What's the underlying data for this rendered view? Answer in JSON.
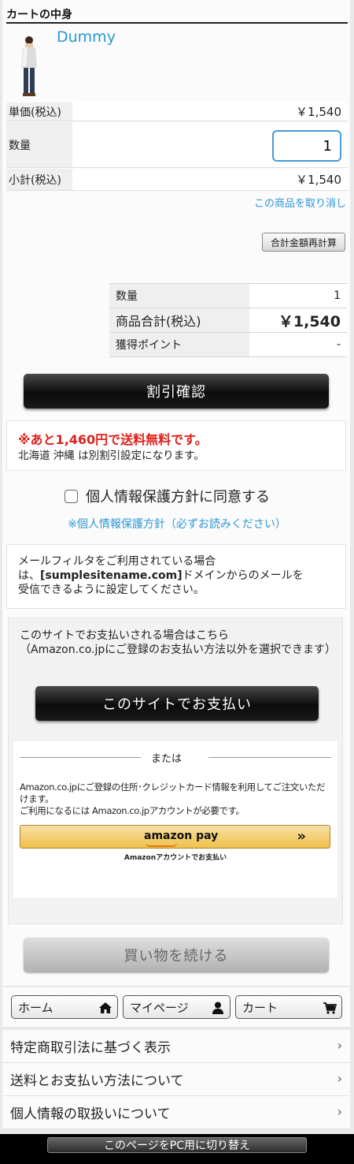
{
  "cart": {
    "title": "カートの中身",
    "product_name": "Dummy",
    "unit_price_label": "単価(税込)",
    "unit_price_value": "￥1,540",
    "qty_label": "数量",
    "qty_value": "1",
    "subtotal_label": "小計(税込)",
    "subtotal_value": "￥1,540",
    "remove_link": "この商品を取り消し",
    "recalc_button": "合計金額再計算"
  },
  "summary": {
    "rows": [
      {
        "label": "数量",
        "value": "1"
      },
      {
        "label": "商品合計(税込)",
        "value": "￥1,540"
      },
      {
        "label": "獲得ポイント",
        "value": "-"
      }
    ]
  },
  "discount_button": "割引確認",
  "shipping": {
    "free_notice": "※あと1,460円で送料無料です。",
    "note": "北海道 沖縄 は別割引設定になります。"
  },
  "consent": {
    "label": "個人情報保護方針に同意する",
    "policy_link": "※個人情報保護方針（必ずお読みください）"
  },
  "mail_notice": {
    "line1": "メールフィルタをご利用されている場合",
    "line2_prefix": "は、",
    "domain": "[sumplesitename.com]",
    "line2_suffix": "ドメインからのメールを",
    "line3": "受信できるように設定してください。"
  },
  "payment": {
    "site_text_line1": "このサイトでお支払いされる場合はこちら",
    "site_text_line2": "（Amazon.co.jpにご登録のお支払い方法以外を選択できます）",
    "site_button": "このサイトでお支払い",
    "or_text": "または",
    "amazon_text_line1": "Amazon.co.jpにご登録の住所･クレジットカード情報を利用してご注文いただけます。",
    "amazon_text_line2": "ご利用になるには Amazon.co.jpアカウントが必要です。",
    "amazon_logo": "amazon pay",
    "amazon_sub": "Amazonアカウントでお支払い"
  },
  "continue_button": "買い物を続ける",
  "nav": {
    "home": "ホーム",
    "mypage": "マイページ",
    "cart": "カート"
  },
  "links": [
    "特定商取引法に基づく表示",
    "送料とお支払い方法について",
    "個人情報の取扱いについて"
  ],
  "footer": {
    "pc_switch": "このページをPC用に切り替え"
  },
  "colors": {
    "accent_blue": "#2a97d6",
    "alert_red": "#e0201a",
    "amazon_yellow": "#f0c14b"
  }
}
